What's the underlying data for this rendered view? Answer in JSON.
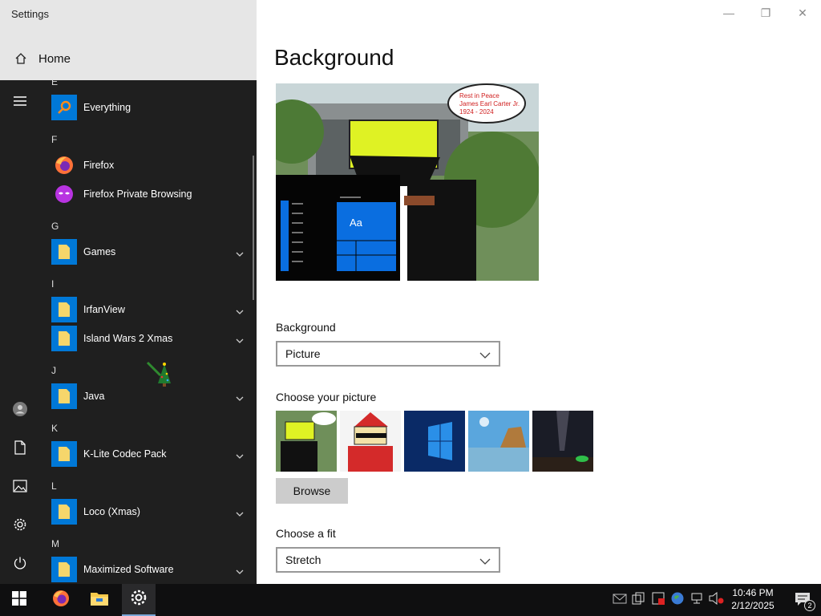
{
  "window": {
    "title": "Settings",
    "controls": {
      "minimize": "—",
      "restore": "❐",
      "close": "✕"
    }
  },
  "nav": {
    "home_label": "Home"
  },
  "page": {
    "title": "Background",
    "background_label": "Background",
    "background_value": "Picture",
    "choose_picture_label": "Choose your picture",
    "browse_label": "Browse",
    "fit_label": "Choose a fit",
    "fit_value": "Stretch",
    "preview_sign": [
      "Rest in Peace",
      "James Earl Carter Jr.",
      "1924 - 2024"
    ],
    "preview_tile_label": "Aa"
  },
  "start_menu": {
    "rail": [
      "hamburger-icon",
      "user-icon",
      "document-icon",
      "pictures-icon",
      "settings-icon",
      "power-icon"
    ],
    "groups": [
      {
        "letter": "E",
        "apps": [
          {
            "name": "Everything",
            "expandable": false,
            "icon": "search-icon"
          }
        ]
      },
      {
        "letter": "F",
        "apps": [
          {
            "name": "Firefox",
            "expandable": false,
            "icon": "firefox-icon"
          },
          {
            "name": "Firefox Private Browsing",
            "expandable": false,
            "icon": "firefox-private-icon"
          }
        ]
      },
      {
        "letter": "G",
        "apps": [
          {
            "name": "Games",
            "expandable": true,
            "icon": "folder-icon"
          }
        ]
      },
      {
        "letter": "I",
        "apps": [
          {
            "name": "IrfanView",
            "expandable": true,
            "icon": "folder-icon"
          },
          {
            "name": "Island Wars 2 Xmas",
            "expandable": true,
            "icon": "folder-icon"
          }
        ]
      },
      {
        "letter": "J",
        "apps": [
          {
            "name": "Java",
            "expandable": true,
            "icon": "folder-icon"
          }
        ]
      },
      {
        "letter": "K",
        "apps": [
          {
            "name": "K-Lite Codec Pack",
            "expandable": true,
            "icon": "folder-icon"
          }
        ]
      },
      {
        "letter": "L",
        "apps": [
          {
            "name": "Loco (Xmas)",
            "expandable": true,
            "icon": "folder-icon"
          }
        ]
      },
      {
        "letter": "M",
        "apps": [
          {
            "name": "Maximized Software",
            "expandable": true,
            "icon": "folder-icon"
          }
        ]
      }
    ]
  },
  "taskbar": {
    "time": "10:46 PM",
    "date": "2/12/2025",
    "notification_count": "2"
  },
  "colors": {
    "accent": "#0078d7",
    "start_bg": "#1f1f1f",
    "taskbar_bg": "#0f0f10",
    "folder_yellow": "#f6d66b"
  }
}
